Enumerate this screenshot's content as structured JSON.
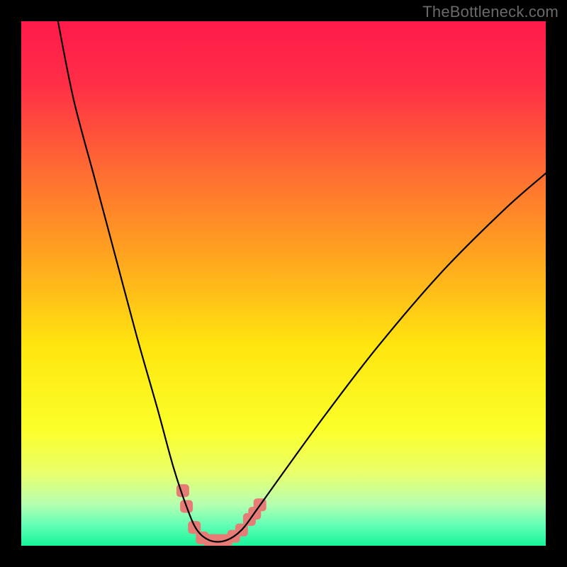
{
  "watermark": {
    "text": "TheBottleneck.com"
  },
  "chart_data": {
    "type": "line",
    "title": "",
    "xlabel": "",
    "ylabel": "",
    "xlim": [
      0,
      100
    ],
    "ylim": [
      0,
      100
    ],
    "grid": false,
    "legend": false,
    "background_gradient": {
      "stops": [
        {
          "pos": 0.0,
          "color": "#ff1a4b"
        },
        {
          "pos": 0.12,
          "color": "#ff2e46"
        },
        {
          "pos": 0.28,
          "color": "#ff6a33"
        },
        {
          "pos": 0.45,
          "color": "#ffa51f"
        },
        {
          "pos": 0.62,
          "color": "#ffe60f"
        },
        {
          "pos": 0.78,
          "color": "#fbff2a"
        },
        {
          "pos": 0.86,
          "color": "#eaff6a"
        },
        {
          "pos": 0.92,
          "color": "#b7ffb0"
        },
        {
          "pos": 0.96,
          "color": "#64ffb6"
        },
        {
          "pos": 1.0,
          "color": "#17f59a"
        }
      ]
    },
    "series": [
      {
        "name": "bottleneck-curve",
        "color": "#000000",
        "points": [
          {
            "x": 7.0,
            "y": 100.0
          },
          {
            "x": 10.0,
            "y": 85.0
          },
          {
            "x": 14.0,
            "y": 70.0
          },
          {
            "x": 18.0,
            "y": 55.0
          },
          {
            "x": 22.0,
            "y": 40.0
          },
          {
            "x": 26.0,
            "y": 26.0
          },
          {
            "x": 29.0,
            "y": 15.0
          },
          {
            "x": 31.5,
            "y": 7.5
          },
          {
            "x": 33.5,
            "y": 3.0
          },
          {
            "x": 36.0,
            "y": 1.0
          },
          {
            "x": 39.0,
            "y": 1.0
          },
          {
            "x": 42.0,
            "y": 3.0
          },
          {
            "x": 45.0,
            "y": 7.0
          },
          {
            "x": 50.0,
            "y": 14.0
          },
          {
            "x": 58.0,
            "y": 25.0
          },
          {
            "x": 68.0,
            "y": 38.0
          },
          {
            "x": 80.0,
            "y": 52.0
          },
          {
            "x": 92.0,
            "y": 64.0
          },
          {
            "x": 100.0,
            "y": 71.0
          }
        ]
      }
    ],
    "markers": {
      "name": "highlight-region",
      "color": "#e77c77",
      "radius_px": 9,
      "points": [
        {
          "x": 30.8,
          "y": 10.5
        },
        {
          "x": 31.5,
          "y": 7.5
        },
        {
          "x": 33.0,
          "y": 3.5
        },
        {
          "x": 34.5,
          "y": 1.5
        },
        {
          "x": 36.0,
          "y": 1.0
        },
        {
          "x": 37.5,
          "y": 1.0
        },
        {
          "x": 39.0,
          "y": 1.0
        },
        {
          "x": 40.5,
          "y": 1.8
        },
        {
          "x": 42.0,
          "y": 3.0
        },
        {
          "x": 43.5,
          "y": 5.0
        },
        {
          "x": 44.5,
          "y": 6.2
        },
        {
          "x": 45.5,
          "y": 7.8
        }
      ]
    }
  }
}
